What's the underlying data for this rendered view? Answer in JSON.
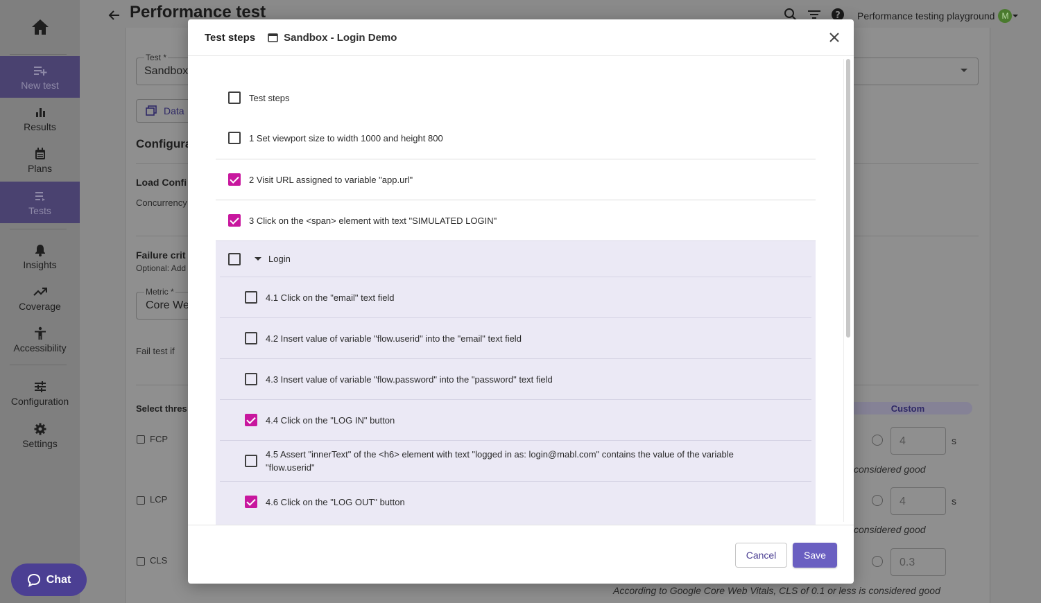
{
  "app": {
    "page_title": "Performance test",
    "workspace": "Performance testing playground",
    "avatar_initial": "M"
  },
  "sidebar": {
    "items": [
      {
        "label": "New test",
        "icon": "playlist-add-icon",
        "active": true
      },
      {
        "label": "Results",
        "icon": "bar-chart-icon"
      },
      {
        "label": "Plans",
        "icon": "calendar-icon"
      },
      {
        "label": "Tests",
        "icon": "list-icon",
        "active": true
      },
      {
        "label": "Insights",
        "icon": "bell-icon"
      },
      {
        "label": "Coverage",
        "icon": "trending-up-icon"
      },
      {
        "label": "Accessibility",
        "icon": "accessibility-icon"
      },
      {
        "label": "Configuration",
        "icon": "sliders-icon"
      },
      {
        "label": "Settings",
        "icon": "gear-icon"
      }
    ],
    "chat_label": "Chat"
  },
  "background": {
    "test_field_label": "Test *",
    "test_field_value": "Sandbox",
    "data_button": "Data",
    "config_heading": "Configura",
    "load_config": "Load Confi",
    "concurrency": "Concurrency",
    "failure_criteria": "Failure crit",
    "failure_optional": "Optional: Add",
    "metric_label": "Metric *",
    "metric_value": "Core We",
    "fail_test_if": "Fail test if",
    "select_threshold": "Select thres",
    "custom_label": "Custom",
    "metrics": [
      {
        "name": "FCP",
        "value": "4",
        "unit": "s",
        "note": "considered good"
      },
      {
        "name": "LCP",
        "value": "4",
        "unit": "s",
        "note": "considered good"
      },
      {
        "name": "CLS",
        "value": "0.3",
        "unit": "",
        "note": "According to Google Core Web Vitals, CLS of 0.1 or less is considered good"
      }
    ]
  },
  "modal": {
    "title": "Test steps",
    "subtitle": "Sandbox - Login Demo",
    "select_all_label": "Test steps",
    "steps": [
      {
        "label": "1 Set viewport size to width 1000 and height 800",
        "checked": false
      },
      {
        "label": "2 Visit URL assigned to variable \"app.url\"",
        "checked": true
      },
      {
        "label": "3 Click on the <span> element with text \"SIMULATED LOGIN\"",
        "checked": true
      }
    ],
    "group": {
      "label": "Login",
      "checked": false,
      "steps": [
        {
          "label": "4.1 Click on the \"email\" text field",
          "checked": false
        },
        {
          "label": "4.2 Insert value of variable \"flow.userid\" into the \"email\" text field",
          "checked": false
        },
        {
          "label": "4.3 Insert value of variable \"flow.password\" into the \"password\" text field",
          "checked": false
        },
        {
          "label": "4.4 Click on the \"LOG IN\" button",
          "checked": true
        },
        {
          "label": "4.5 Assert \"innerText\" of the <h6> element with text \"logged in as: login@mabl.com\" contains the value of the variable \"flow.userid\"",
          "checked": false
        },
        {
          "label": "4.6 Click on the \"LOG OUT\" button",
          "checked": true
        }
      ]
    },
    "cancel_label": "Cancel",
    "save_label": "Save"
  }
}
